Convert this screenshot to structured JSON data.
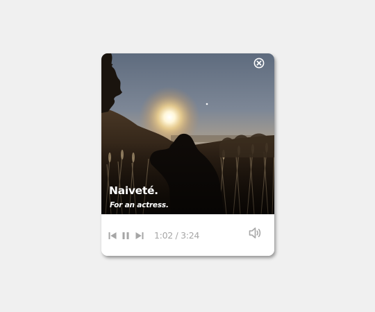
{
  "player": {
    "track": {
      "title": "Naiveté.",
      "subtitle": "For an actress."
    },
    "controls": {
      "prev_icon": "skip-previous-icon",
      "pause_icon": "pause-icon",
      "next_icon": "skip-next-icon",
      "volume_icon": "volume-icon",
      "close_icon": "close-circle-icon"
    },
    "time_display": "1:02 / 3:24"
  },
  "colors": {
    "page_background": "#f0f0f0",
    "card_background": "#ffffff",
    "control_icons": "#a6a6a6",
    "time_text": "#a6a6a6",
    "overlay_text": "#ffffff"
  }
}
